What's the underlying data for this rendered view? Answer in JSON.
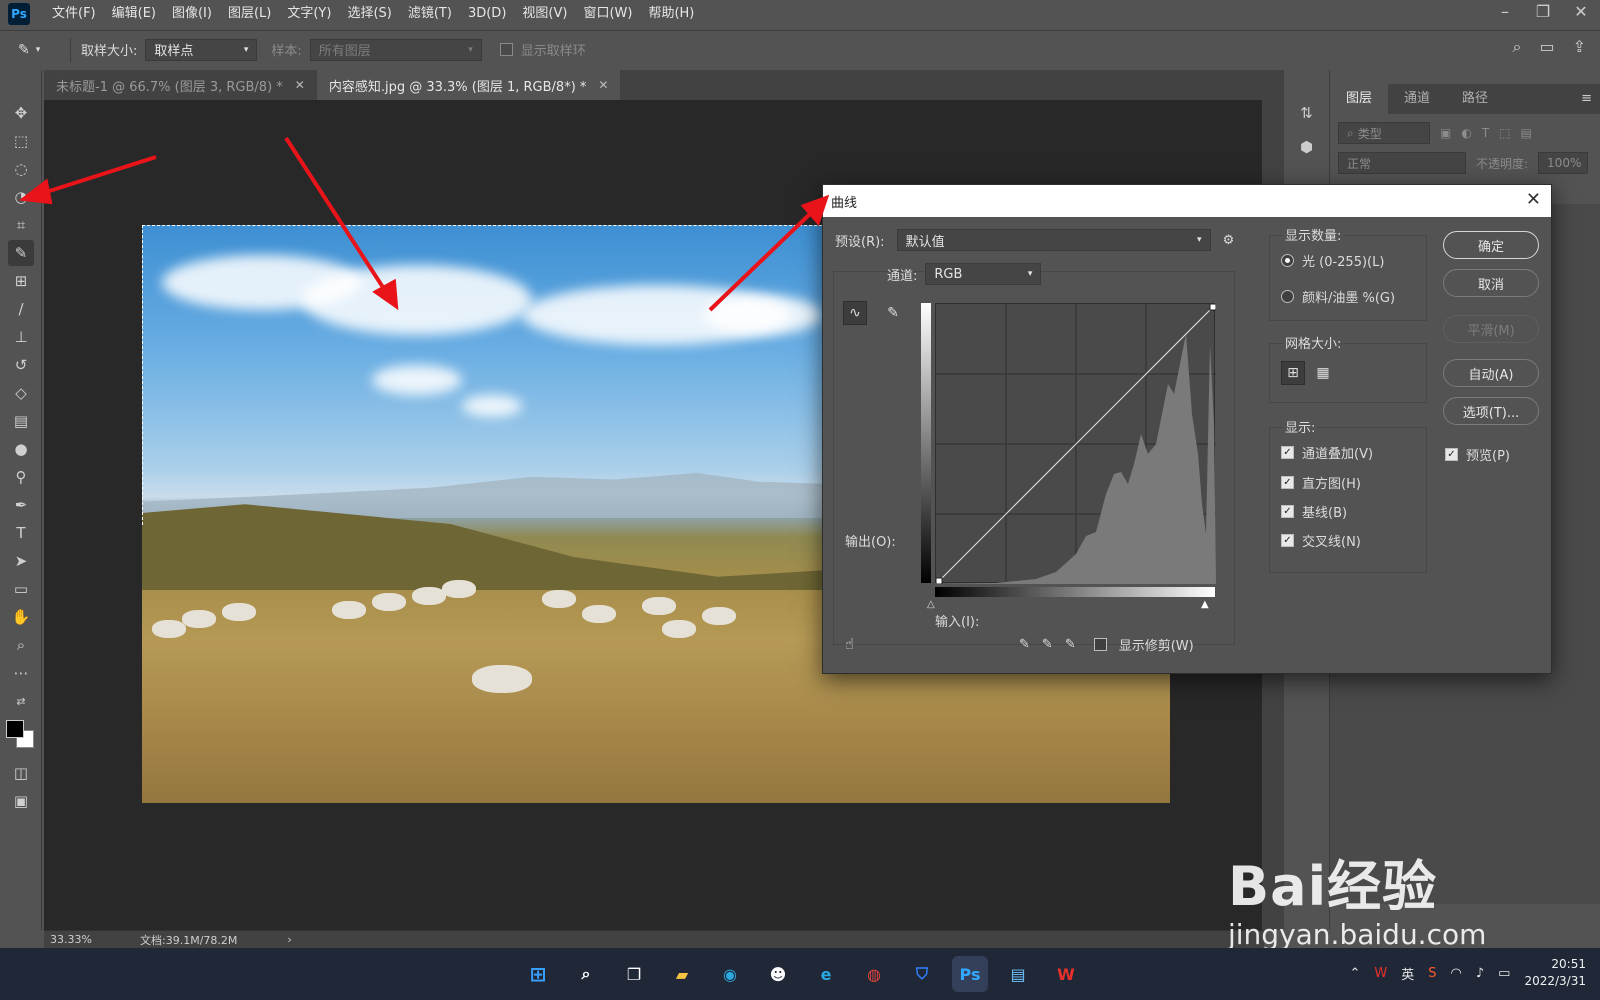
{
  "app": {
    "logo": "Ps"
  },
  "menu": [
    "文件(F)",
    "编辑(E)",
    "图像(I)",
    "图层(L)",
    "文字(Y)",
    "选择(S)",
    "滤镜(T)",
    "3D(D)",
    "视图(V)",
    "窗口(W)",
    "帮助(H)"
  ],
  "options": {
    "sample_size_label": "取样大小:",
    "sample_size_value": "取样点",
    "sample_label": "样本:",
    "sample_value": "所有图层",
    "show_ring_label": "显示取样环"
  },
  "tabs": [
    {
      "label": "未标题-1 @ 66.7% (图层 3, RGB/8) *",
      "active": false
    },
    {
      "label": "内容感知.jpg @ 33.3% (图层 1, RGB/8*) *",
      "active": true
    }
  ],
  "status": {
    "zoom": "33.33%",
    "doc": "文档:39.1M/78.2M"
  },
  "layers_panel": {
    "tabs": [
      "图层",
      "通道",
      "路径"
    ],
    "filter_placeholder": "类型",
    "blend_mode": "正常",
    "opacity_label": "不透明度:",
    "opacity_value": "100%"
  },
  "curves_dialog": {
    "title": "曲线",
    "preset_label": "预设(R):",
    "preset_value": "默认值",
    "channel_label": "通道:",
    "channel_value": "RGB",
    "output_label": "输出(O):",
    "input_label": "输入(I):",
    "show_clipping_label": "显示修剪(W)",
    "display_amount_title": "显示数量:",
    "light_label": "光 (0-255)(L)",
    "pigment_label": "颜料/油墨 %(G)",
    "grid_size_title": "网格大小:",
    "show_title": "显示:",
    "show_options": [
      "通道叠加(V)",
      "直方图(H)",
      "基线(B)",
      "交叉线(N)"
    ],
    "buttons": {
      "ok": "确定",
      "cancel": "取消",
      "smooth": "平滑(M)",
      "auto": "自动(A)",
      "options": "选项(T)..."
    },
    "preview_label": "预览(P)"
  },
  "taskbar": {
    "ime": "英",
    "time": "20:51",
    "date": "2022/3/31"
  },
  "watermark": {
    "brand": "Bai经验",
    "url": "jingyan.baidu.com"
  },
  "colors": {
    "accent": "#31a8ff",
    "arrow": "#e8141a",
    "panel": "#535353",
    "canvas": "#282828"
  }
}
